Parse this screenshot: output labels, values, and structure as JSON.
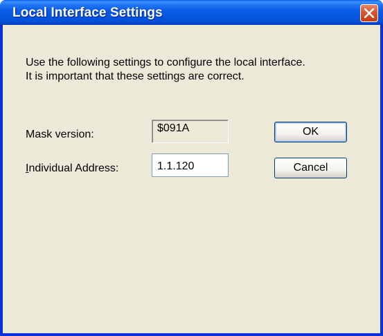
{
  "window": {
    "title": "Local Interface Settings"
  },
  "titlebar": {
    "close_icon": "close-x-icon",
    "close_color": "#d8542c"
  },
  "description": {
    "line1": "Use the following settings to configure the local interface.",
    "line2": "It is important that these settings are correct."
  },
  "mask_version": {
    "label": "Mask version:",
    "value": "$091A"
  },
  "individual_address": {
    "label_mnemonic": "I",
    "label_rest": "ndividual Address:",
    "value": "1.1.120"
  },
  "buttons": {
    "ok_label": "OK",
    "cancel_label": "Cancel"
  }
}
